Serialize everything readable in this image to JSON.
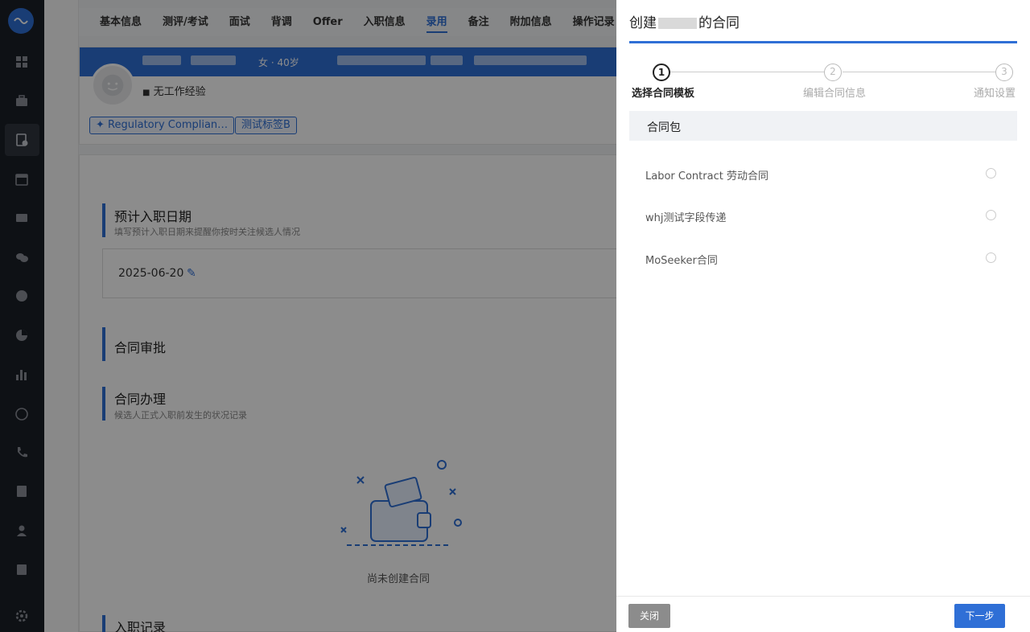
{
  "tabs": [
    "基本信息",
    "测评/考试",
    "面试",
    "背调",
    "Offer",
    "入职信息",
    "录用",
    "备注",
    "附加信息",
    "操作记录"
  ],
  "active_tab_index": 6,
  "profile": {
    "gender_age": "女 · 40岁",
    "experience": "无工作经验",
    "tag1": "Regulatory Complian…",
    "tag2": "测试标签B"
  },
  "sections": {
    "entry_date_title": "预计入职日期",
    "entry_date_sub": "填写预计入职日期来提醒你按时关注候选人情况",
    "entry_date_value": "2025-06-20",
    "approval_title": "合同审批",
    "handling_title": "合同办理",
    "handling_sub": "候选人正式入职前发生的状况记录",
    "empty_text": "尚未创建合同",
    "records_title": "入职记录"
  },
  "drawer": {
    "title_prefix": "创建",
    "title_suffix": "的合同",
    "steps": [
      {
        "num": "1",
        "label": "选择合同模板"
      },
      {
        "num": "2",
        "label": "编辑合同信息"
      },
      {
        "num": "3",
        "label": "通知设置"
      }
    ],
    "active_step": 1,
    "package_label": "合同包",
    "options": [
      {
        "label": "Labor Contract 劳动合同",
        "selected": false
      },
      {
        "label": "whj测试字段传递",
        "selected": false
      },
      {
        "label": "MoSeeker合同",
        "selected": false
      }
    ],
    "close_label": "关闭",
    "next_label": "下一步"
  },
  "colors": {
    "accent": "#2f6fd6",
    "sidebar": "#1b1f27"
  }
}
